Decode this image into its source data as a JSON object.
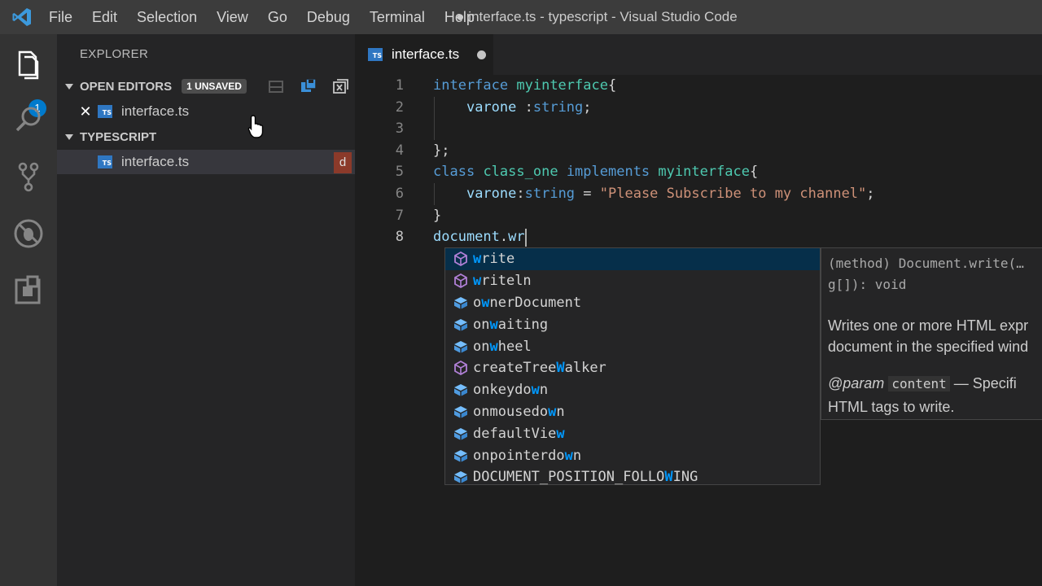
{
  "titlebar": {
    "menu": [
      "File",
      "Edit",
      "Selection",
      "View",
      "Go",
      "Debug",
      "Terminal",
      "Help"
    ],
    "window_title": "● interface.ts - typescript - Visual Studio Code"
  },
  "activitybar": {
    "icons": [
      "explorer-icon",
      "search-icon",
      "source-control-icon",
      "debug-icon",
      "extensions-icon"
    ],
    "explorer_badge": "1"
  },
  "sidebar": {
    "title": "EXPLORER",
    "open_editors": {
      "label": "OPEN EDITORS",
      "badge": "1 UNSAVED",
      "file": "interface.ts",
      "close_glyph": "✕"
    },
    "workspace": {
      "label": "TYPESCRIPT",
      "file": "interface.ts",
      "decoration": "d"
    }
  },
  "editor": {
    "tab": {
      "label": "interface.ts",
      "icon_text": "TS"
    },
    "line_numbers": [
      "1",
      "2",
      "3",
      "4",
      "5",
      "6",
      "7",
      "8"
    ],
    "lines": [
      [
        [
          "kw",
          "interface"
        ],
        [
          "",
          " "
        ],
        [
          "ty",
          "myinterface"
        ],
        [
          "",
          "{"
        ]
      ],
      [
        [
          "",
          "    "
        ],
        [
          "id",
          "varone"
        ],
        [
          "",
          " :"
        ],
        [
          "kw",
          "string"
        ],
        [
          "",
          ";"
        ]
      ],
      [],
      [
        [
          "",
          "};"
        ]
      ],
      [
        [
          "kw",
          "class"
        ],
        [
          "",
          " "
        ],
        [
          "ty",
          "class_one"
        ],
        [
          "",
          " "
        ],
        [
          "kw",
          "implements"
        ],
        [
          "",
          " "
        ],
        [
          "ty",
          "myinterface"
        ],
        [
          "",
          "{"
        ]
      ],
      [
        [
          "",
          "    "
        ],
        [
          "id",
          "varone"
        ],
        [
          "",
          ":"
        ],
        [
          "kw",
          "string"
        ],
        [
          "",
          " = "
        ],
        [
          "str",
          "\"Please Subscribe to my channel\""
        ],
        [
          "",
          ";"
        ]
      ],
      [
        [
          "",
          "}"
        ]
      ],
      [
        [
          "id",
          "document"
        ],
        [
          "",
          "."
        ],
        [
          "id",
          "wr"
        ]
      ]
    ]
  },
  "suggest": {
    "items": [
      {
        "kind": "method",
        "parts": [
          [
            "w",
            true
          ],
          [
            "rite",
            false
          ]
        ]
      },
      {
        "kind": "method",
        "parts": [
          [
            "w",
            true
          ],
          [
            "riteln",
            false
          ]
        ]
      },
      {
        "kind": "property",
        "parts": [
          [
            "o",
            false
          ],
          [
            "w",
            true
          ],
          [
            "nerDocument",
            false
          ]
        ]
      },
      {
        "kind": "property",
        "parts": [
          [
            "on",
            false
          ],
          [
            "w",
            true
          ],
          [
            "aiting",
            false
          ]
        ]
      },
      {
        "kind": "property",
        "parts": [
          [
            "on",
            false
          ],
          [
            "w",
            true
          ],
          [
            "heel",
            false
          ]
        ]
      },
      {
        "kind": "method",
        "parts": [
          [
            "createTree",
            false
          ],
          [
            "W",
            true
          ],
          [
            "alker",
            false
          ]
        ]
      },
      {
        "kind": "property",
        "parts": [
          [
            "onkeydo",
            false
          ],
          [
            "w",
            true
          ],
          [
            "n",
            false
          ]
        ]
      },
      {
        "kind": "property",
        "parts": [
          [
            "onmousedo",
            false
          ],
          [
            "w",
            true
          ],
          [
            "n",
            false
          ]
        ]
      },
      {
        "kind": "property",
        "parts": [
          [
            "defaultVie",
            false
          ],
          [
            "w",
            true
          ]
        ]
      },
      {
        "kind": "property",
        "parts": [
          [
            "onpointerdo",
            false
          ],
          [
            "w",
            true
          ],
          [
            "n",
            false
          ]
        ]
      },
      {
        "kind": "property",
        "parts": [
          [
            "DOCUMENT_POSITION_FOLLO",
            false
          ],
          [
            "W",
            true
          ],
          [
            "ING",
            false
          ]
        ]
      }
    ],
    "details": {
      "signature_line1": "(method) Document.write(…",
      "signature_line2": "g[]): void",
      "doc_line1": "Writes one or more HTML expr",
      "doc_line2": "document in the specified wind",
      "param_tag": "@param",
      "param_name": "content",
      "param_rest": " — Specifi",
      "param_line2": "HTML tags to write."
    }
  },
  "colors": {
    "accent": "#007acc",
    "keyword": "#569cd6",
    "type": "#4ec9b0",
    "identifier": "#9cdcfe",
    "string": "#ce9178",
    "match_highlight": "#0097fb"
  }
}
